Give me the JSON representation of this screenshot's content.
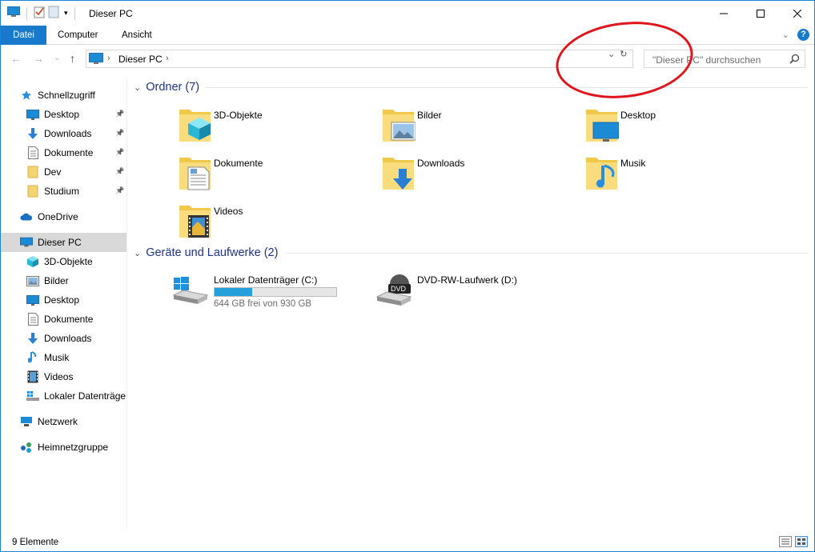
{
  "window": {
    "title": "Dieser PC"
  },
  "ribbon": {
    "tabs": [
      "Datei",
      "Computer",
      "Ansicht"
    ]
  },
  "address": {
    "path": "Dieser PC"
  },
  "search": {
    "placeholder": "\"Dieser PC\" durchsuchen"
  },
  "sidebar": {
    "items": [
      {
        "label": "Schnellzugriff",
        "icon": "star-icon",
        "pinned": false,
        "level": 0
      },
      {
        "label": "Desktop",
        "icon": "desktop-icon",
        "pinned": true,
        "level": 1
      },
      {
        "label": "Downloads",
        "icon": "download-arrow-icon",
        "pinned": true,
        "level": 1
      },
      {
        "label": "Dokumente",
        "icon": "document-icon",
        "pinned": true,
        "level": 1
      },
      {
        "label": "Dev",
        "icon": "folder-icon",
        "pinned": true,
        "level": 1
      },
      {
        "label": "Studium",
        "icon": "folder-icon",
        "pinned": true,
        "level": 1
      },
      {
        "label": "OneDrive",
        "icon": "cloud-icon",
        "pinned": false,
        "level": 0
      },
      {
        "label": "Dieser PC",
        "icon": "computer-icon",
        "pinned": false,
        "level": 0,
        "selected": true
      },
      {
        "label": "3D-Objekte",
        "icon": "cube-icon",
        "pinned": false,
        "level": 1
      },
      {
        "label": "Bilder",
        "icon": "picture-icon",
        "pinned": false,
        "level": 1
      },
      {
        "label": "Desktop",
        "icon": "desktop-icon",
        "pinned": false,
        "level": 1
      },
      {
        "label": "Dokumente",
        "icon": "document-icon",
        "pinned": false,
        "level": 1
      },
      {
        "label": "Downloads",
        "icon": "download-arrow-icon",
        "pinned": false,
        "level": 1
      },
      {
        "label": "Musik",
        "icon": "music-note-icon",
        "pinned": false,
        "level": 1
      },
      {
        "label": "Videos",
        "icon": "film-icon",
        "pinned": false,
        "level": 1
      },
      {
        "label": "Lokaler Datenträger",
        "icon": "drive-icon",
        "pinned": false,
        "level": 1
      },
      {
        "label": "Netzwerk",
        "icon": "network-icon",
        "pinned": false,
        "level": 0
      },
      {
        "label": "Heimnetzgruppe",
        "icon": "homegroup-icon",
        "pinned": false,
        "level": 0
      }
    ]
  },
  "main": {
    "folders_header": "Ordner (7)",
    "folders": [
      {
        "label": "3D-Objekte",
        "icon": "folder-3d-objects-icon"
      },
      {
        "label": "Bilder",
        "icon": "folder-pictures-icon"
      },
      {
        "label": "Desktop",
        "icon": "folder-desktop-icon"
      },
      {
        "label": "Dokumente",
        "icon": "folder-documents-icon"
      },
      {
        "label": "Downloads",
        "icon": "folder-downloads-icon"
      },
      {
        "label": "Musik",
        "icon": "folder-music-icon"
      },
      {
        "label": "Videos",
        "icon": "folder-videos-icon"
      }
    ],
    "devices_header": "Geräte und Laufwerke (2)",
    "devices": [
      {
        "label": "Lokaler Datenträger (C:)",
        "free_text": "644 GB frei von 930 GB",
        "used_fraction": 0.31,
        "icon": "windows-drive-icon"
      },
      {
        "label": "DVD-RW-Laufwerk (D:)",
        "icon": "dvd-drive-icon",
        "badge": "DVD"
      }
    ]
  },
  "status": {
    "count": "9 Elemente"
  },
  "colors": {
    "accent": "#1979ca",
    "header": "#1e3287",
    "drive_fill": "#26a0da",
    "annotation": "#e0141b"
  }
}
